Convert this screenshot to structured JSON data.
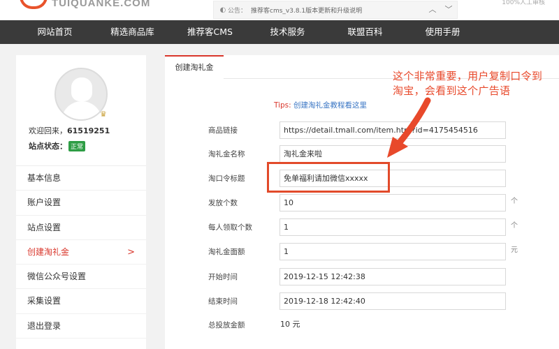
{
  "header": {
    "logo_text": "TUIQUANKE.COM",
    "notice_label": "公告：",
    "notice_text": "推荐客cms_v3.8.1版本更新和升级说明",
    "notice_prev_icon": "chevron-up",
    "notice_next_icon": "chevron-down",
    "top_right_text": "100%人工审核"
  },
  "nav": {
    "items": [
      {
        "label": "网站首页"
      },
      {
        "label": "精选商品库"
      },
      {
        "label": "推荐客CMS"
      },
      {
        "label": "技术服务"
      },
      {
        "label": "联盟百科"
      },
      {
        "label": "使用手册"
      }
    ]
  },
  "sidebar": {
    "welcome_prefix": "欢迎回来，",
    "username": "61519251",
    "status_label": "站点状态：",
    "status_value": "正常",
    "menu": [
      {
        "label": "基本信息"
      },
      {
        "label": "账户设置"
      },
      {
        "label": "站点设置"
      },
      {
        "label": "创建淘礼金",
        "active": true
      },
      {
        "label": "微信公众号设置"
      },
      {
        "label": "采集设置"
      },
      {
        "label": "退出登录"
      }
    ],
    "active_chevron": ">"
  },
  "main": {
    "tab_label": "创建淘礼金",
    "tips_label": "Tips:",
    "tips_link": "创建淘礼金教程看这里",
    "form": {
      "product_link": {
        "label": "商品链接",
        "value": "https://detail.tmall.com/item.htm?id=4175454516"
      },
      "gift_name": {
        "label": "淘礼金名称",
        "value": "淘礼金来啦"
      },
      "tao_title": {
        "label": "淘口令标题",
        "value": "免单福利请加微信xxxxx"
      },
      "issue_count": {
        "label": "发放个数",
        "value": "10",
        "unit": "个"
      },
      "per_user": {
        "label": "每人领取个数",
        "value": "1",
        "unit": "个"
      },
      "face_value": {
        "label": "淘礼金面额",
        "value": "1",
        "unit": "元"
      },
      "start_time": {
        "label": "开始时间",
        "value": "2019-12-15 12:42:38"
      },
      "end_time": {
        "label": "结束时间",
        "value": "2019-12-18 12:42:40"
      },
      "total_amount": {
        "label": "总投放金额",
        "value": "10 元"
      }
    }
  },
  "annotation": {
    "text": "这个非常重要，用户复制口令到淘宝，会看到这个广告语",
    "color": "#e8492b"
  },
  "colors": {
    "accent_red": "#d9362b",
    "nav_bg": "#3a3a3a",
    "status_green": "#2e9d45",
    "link_blue": "#3a76c4"
  }
}
